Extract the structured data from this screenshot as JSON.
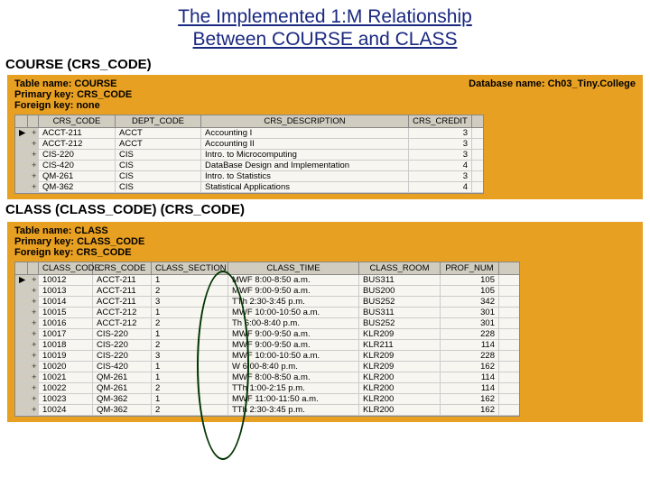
{
  "title_line1": "The Implemented 1:M Relationship",
  "title_line2": "Between COURSE and CLASS",
  "section1_label": "COURSE (CRS_CODE)",
  "section2_label": "CLASS (CLASS_CODE) (CRS_CODE)",
  "db_name_label": "Database name: Ch03_Tiny.College",
  "course_meta": {
    "table": "Table name: COURSE",
    "pk": "Primary key: CRS_CODE",
    "fk": "Foreign key: none"
  },
  "class_meta": {
    "table": "Table name: CLASS",
    "pk": "Primary key: CLASS_CODE",
    "fk": "Foreign key: CRS_CODE"
  },
  "course_headers": [
    "CRS_CODE",
    "DEPT_CODE",
    "CRS_DESCRIPTION",
    "CRS_CREDIT"
  ],
  "course_rows": [
    {
      "crs": "ACCT-211",
      "dept": "ACCT",
      "desc": "Accounting I",
      "cred": "3"
    },
    {
      "crs": "ACCT-212",
      "dept": "ACCT",
      "desc": "Accounting II",
      "cred": "3"
    },
    {
      "crs": "CIS-220",
      "dept": "CIS",
      "desc": "Intro. to Microcomputing",
      "cred": "3"
    },
    {
      "crs": "CIS-420",
      "dept": "CIS",
      "desc": "DataBase Design and Implementation",
      "cred": "4"
    },
    {
      "crs": "QM-261",
      "dept": "CIS",
      "desc": "Intro. to Statistics",
      "cred": "3"
    },
    {
      "crs": "QM-362",
      "dept": "CIS",
      "desc": "Statistical Applications",
      "cred": "4"
    }
  ],
  "class_headers": [
    "CLASS_CODE",
    "CRS_CODE",
    "CLASS_SECTION",
    "CLASS_TIME",
    "CLASS_ROOM",
    "PROF_NUM"
  ],
  "class_rows": [
    {
      "code": "10012",
      "crs": "ACCT-211",
      "sec": "1",
      "time": "MWF 8:00-8:50 a.m.",
      "room": "BUS311",
      "prof": "105"
    },
    {
      "code": "10013",
      "crs": "ACCT-211",
      "sec": "2",
      "time": "MWF 9:00-9:50 a.m.",
      "room": "BUS200",
      "prof": "105"
    },
    {
      "code": "10014",
      "crs": "ACCT-211",
      "sec": "3",
      "time": "TTh 2:30-3:45 p.m.",
      "room": "BUS252",
      "prof": "342"
    },
    {
      "code": "10015",
      "crs": "ACCT-212",
      "sec": "1",
      "time": "MWF 10:00-10:50 a.m.",
      "room": "BUS311",
      "prof": "301"
    },
    {
      "code": "10016",
      "crs": "ACCT-212",
      "sec": "2",
      "time": "Th 6:00-8:40 p.m.",
      "room": "BUS252",
      "prof": "301"
    },
    {
      "code": "10017",
      "crs": "CIS-220",
      "sec": "1",
      "time": "MWF 9:00-9:50 a.m.",
      "room": "KLR209",
      "prof": "228"
    },
    {
      "code": "10018",
      "crs": "CIS-220",
      "sec": "2",
      "time": "MWF 9:00-9:50 a.m.",
      "room": "KLR211",
      "prof": "114"
    },
    {
      "code": "10019",
      "crs": "CIS-220",
      "sec": "3",
      "time": "MWF 10:00-10:50 a.m.",
      "room": "KLR209",
      "prof": "228"
    },
    {
      "code": "10020",
      "crs": "CIS-420",
      "sec": "1",
      "time": "W 6:00-8:40 p.m.",
      "room": "KLR209",
      "prof": "162"
    },
    {
      "code": "10021",
      "crs": "QM-261",
      "sec": "1",
      "time": "MWF 8:00-8:50 a.m.",
      "room": "KLR200",
      "prof": "114"
    },
    {
      "code": "10022",
      "crs": "QM-261",
      "sec": "2",
      "time": "TTh 1:00-2:15 p.m.",
      "room": "KLR200",
      "prof": "114"
    },
    {
      "code": "10023",
      "crs": "QM-362",
      "sec": "1",
      "time": "MWF 11:00-11:50 a.m.",
      "room": "KLR200",
      "prof": "162"
    },
    {
      "code": "10024",
      "crs": "QM-362",
      "sec": "2",
      "time": "TTh 2:30-3:45 p.m.",
      "room": "KLR200",
      "prof": "162"
    }
  ],
  "expand_glyph": "+",
  "row_marker": "▶"
}
